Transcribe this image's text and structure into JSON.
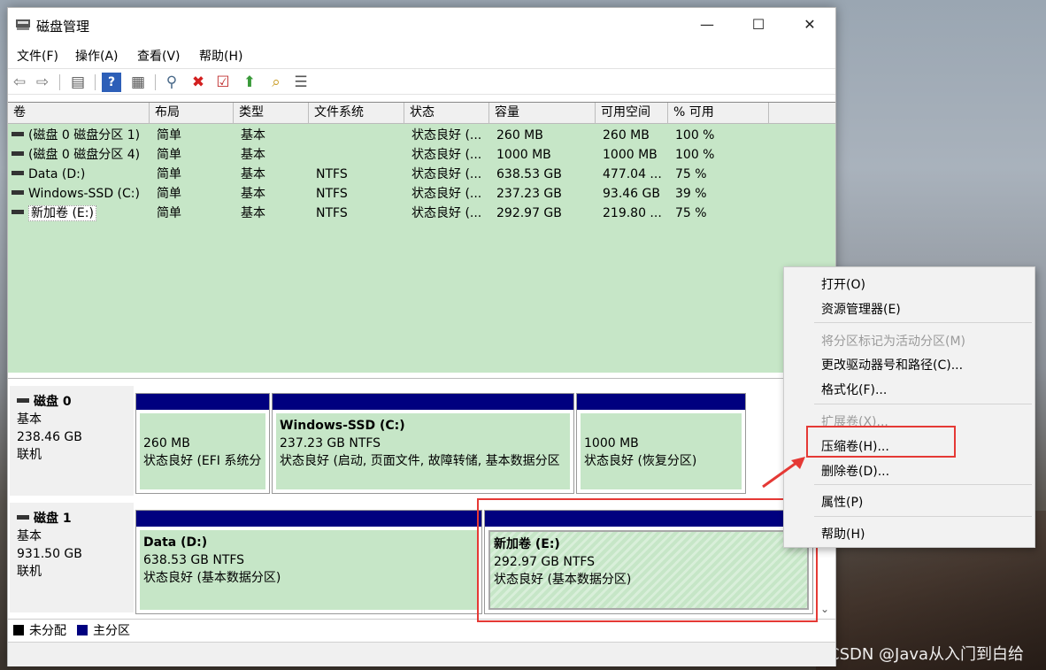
{
  "window": {
    "title": "磁盘管理",
    "controls": {
      "minimize": "—",
      "maximize": "☐",
      "close": "✕"
    }
  },
  "menu": [
    "文件(F)",
    "操作(A)",
    "查看(V)",
    "帮助(H)"
  ],
  "toolbar": {
    "icons": [
      "back-icon",
      "forward-icon",
      "properties-icon",
      "help-icon",
      "console-icon",
      "connect-icon",
      "delete-icon",
      "check-icon",
      "up-icon",
      "search-icon",
      "list-icon"
    ]
  },
  "volume_table": {
    "headers": [
      "卷",
      "布局",
      "类型",
      "文件系统",
      "状态",
      "容量",
      "可用空间",
      "% 可用"
    ],
    "rows": [
      [
        "(磁盘 0 磁盘分区 1)",
        "简单",
        "基本",
        "",
        "状态良好 (...",
        "260 MB",
        "260 MB",
        "100 %"
      ],
      [
        "(磁盘 0 磁盘分区 4)",
        "简单",
        "基本",
        "",
        "状态良好 (...",
        "1000 MB",
        "1000 MB",
        "100 %"
      ],
      [
        "Data (D:)",
        "简单",
        "基本",
        "NTFS",
        "状态良好 (...",
        "638.53 GB",
        "477.04 ...",
        "75 %"
      ],
      [
        "Windows-SSD (C:)",
        "简单",
        "基本",
        "NTFS",
        "状态良好 (...",
        "237.23 GB",
        "93.46 GB",
        "39 %"
      ],
      [
        "新加卷 (E:)",
        "简单",
        "基本",
        "NTFS",
        "状态良好 (...",
        "292.97 GB",
        "219.80 ...",
        "75 %"
      ]
    ]
  },
  "disks": [
    {
      "name": "磁盘 0",
      "type": "基本",
      "size": "238.46 GB",
      "status": "联机",
      "partitions": [
        {
          "title": "",
          "line1": "260 MB",
          "line2": "状态良好 (EFI 系统分"
        },
        {
          "title": "Windows-SSD  (C:)",
          "line1": "237.23 GB NTFS",
          "line2": "状态良好 (启动, 页面文件, 故障转储, 基本数据分区"
        },
        {
          "title": "",
          "line1": "1000 MB",
          "line2": "状态良好 (恢复分区)"
        }
      ]
    },
    {
      "name": "磁盘 1",
      "type": "基本",
      "size": "931.50 GB",
      "status": "联机",
      "partitions": [
        {
          "title": "Data  (D:)",
          "line1": "638.53 GB NTFS",
          "line2": "状态良好 (基本数据分区)"
        },
        {
          "title": "新加卷  (E:)",
          "line1": "292.97 GB NTFS",
          "line2": "状态良好 (基本数据分区)"
        }
      ]
    }
  ],
  "legend": {
    "unallocated": "未分配",
    "primary": "主分区",
    "unallocated_color": "#000000",
    "primary_color": "#00007f"
  },
  "context_menu": {
    "items": [
      {
        "label": "打开(O)",
        "disabled": false
      },
      {
        "label": "资源管理器(E)",
        "disabled": false
      },
      {
        "label": "将分区标记为活动分区(M)",
        "disabled": true
      },
      {
        "label": "更改驱动器号和路径(C)...",
        "disabled": false
      },
      {
        "label": "格式化(F)...",
        "disabled": false
      },
      {
        "label": "扩展卷(X)...",
        "disabled": true
      },
      {
        "label": "压缩卷(H)...",
        "disabled": false
      },
      {
        "label": "删除卷(D)...",
        "disabled": false
      },
      {
        "label": "属性(P)",
        "disabled": false
      },
      {
        "label": "帮助(H)",
        "disabled": false
      }
    ]
  },
  "colors": {
    "green": "#c6e6c7",
    "partition_header": "#00007f",
    "highlight": "#e53935"
  },
  "watermark": "CSDN @Java从入门到白给"
}
